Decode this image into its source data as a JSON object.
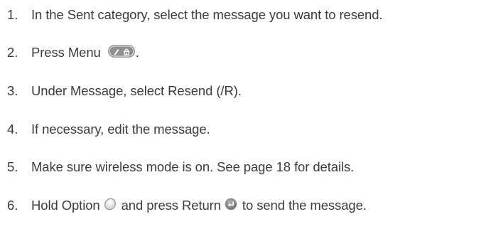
{
  "steps": [
    {
      "num": "1.",
      "text": "In the Sent category, select the message you want to resend."
    },
    {
      "num": "2.",
      "text_before": "Press Menu",
      "text_after": ".",
      "icon": "menu-key-icon"
    },
    {
      "num": "3.",
      "text": "Under Message, select Resend (/R)."
    },
    {
      "num": "4.",
      "text": "If necessary, edit the message."
    },
    {
      "num": "5.",
      "text": "Make sure wireless mode is on. See page 18 for details."
    },
    {
      "num": "6.",
      "text_before": "Hold Option",
      "text_middle": "and press Return",
      "text_after": "to send the message.",
      "icons": [
        "option-key-icon",
        "return-key-icon"
      ]
    }
  ],
  "colors": {
    "text": "#3c3c3c",
    "key_fill": "#e4e4e4",
    "key_stroke": "#9a9a9a",
    "key_dark": "#8a8a8a"
  }
}
